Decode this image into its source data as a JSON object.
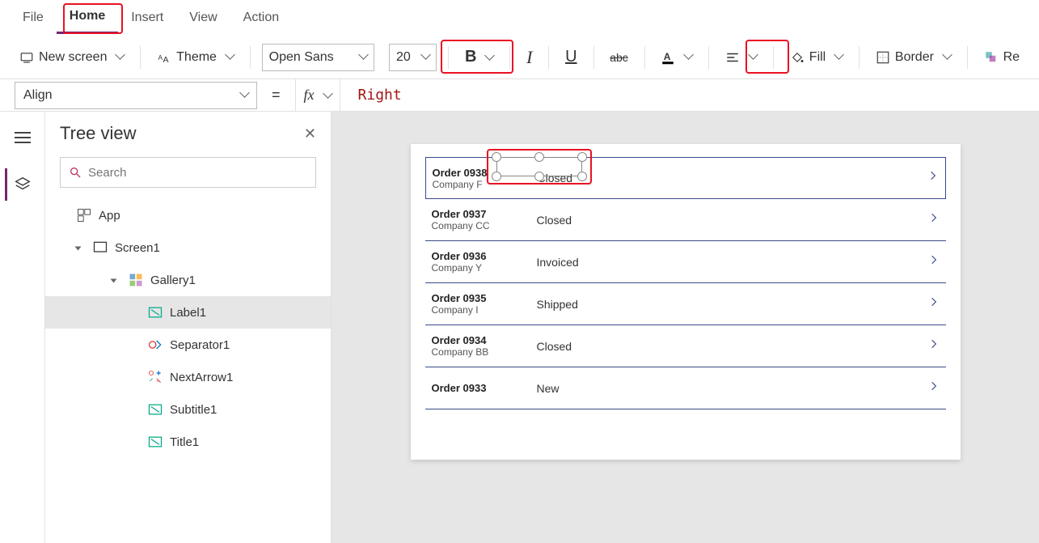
{
  "menubar": {
    "tabs": [
      "File",
      "Home",
      "Insert",
      "View",
      "Action"
    ],
    "active": "Home"
  },
  "ribbon": {
    "new_screen": "New screen",
    "theme": "Theme",
    "font_family": "Open Sans",
    "font_size": "20",
    "bold": "B",
    "fill": "Fill",
    "border": "Border",
    "reorder": "Re"
  },
  "formula": {
    "property": "Align",
    "value": "Right"
  },
  "tree": {
    "title": "Tree view",
    "search_placeholder": "Search",
    "items": [
      {
        "label": "App",
        "icon": "app",
        "indent": 1
      },
      {
        "label": "Screen1",
        "icon": "screen",
        "indent": 2,
        "caret": true
      },
      {
        "label": "Gallery1",
        "icon": "gallery",
        "indent": 3,
        "caret": true
      },
      {
        "label": "Label1",
        "icon": "label",
        "indent": 4,
        "selected": true
      },
      {
        "label": "Separator1",
        "icon": "separator",
        "indent": 4
      },
      {
        "label": "NextArrow1",
        "icon": "nextarrow",
        "indent": 4
      },
      {
        "label": "Subtitle1",
        "icon": "label",
        "indent": 4
      },
      {
        "label": "Title1",
        "icon": "label",
        "indent": 4
      }
    ]
  },
  "gallery": [
    {
      "title": "Order 0938",
      "subtitle": "Company F",
      "status": "Closed",
      "selected": true
    },
    {
      "title": "Order 0937",
      "subtitle": "Company CC",
      "status": "Closed"
    },
    {
      "title": "Order 0936",
      "subtitle": "Company Y",
      "status": "Invoiced"
    },
    {
      "title": "Order 0935",
      "subtitle": "Company I",
      "status": "Shipped"
    },
    {
      "title": "Order 0934",
      "subtitle": "Company BB",
      "status": "Closed"
    },
    {
      "title": "Order 0933",
      "subtitle": "",
      "status": "New"
    }
  ],
  "highlights": {
    "home_tab": true,
    "font_size": true,
    "align_button": true,
    "status_label": true
  }
}
